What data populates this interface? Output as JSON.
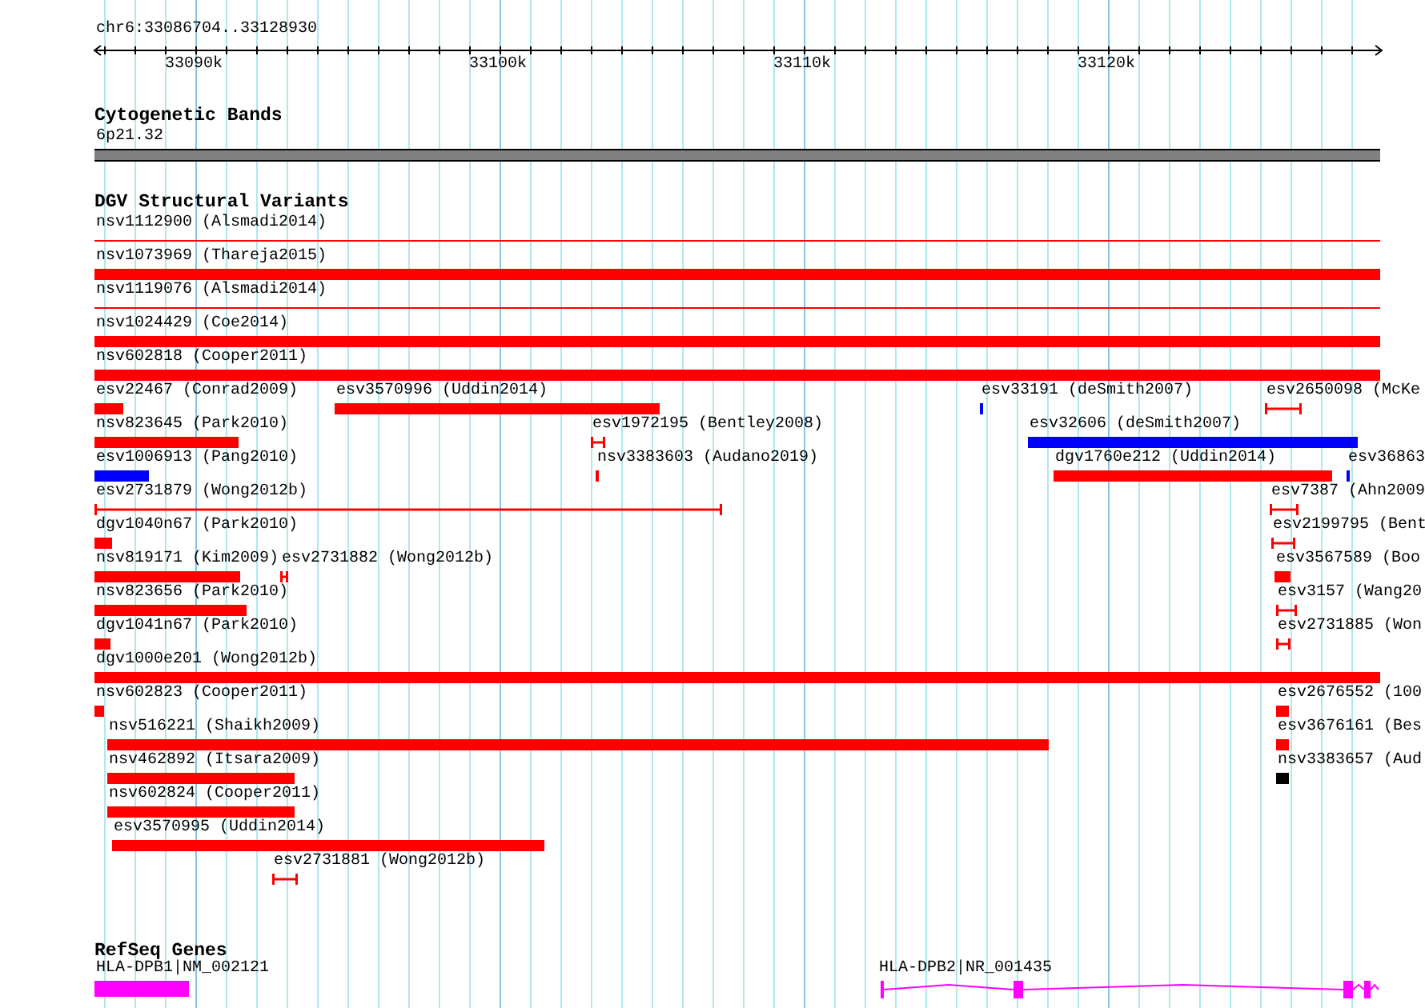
{
  "ruler": {
    "label": "chr6:33086704..33128930",
    "ticks": [
      "33090k",
      "33100k",
      "33110k",
      "33120k"
    ]
  },
  "bands": {
    "title": "Cytogenetic Bands",
    "label": "6p21.32"
  },
  "variants": {
    "title": "DGV Structural Variants",
    "features": [
      {
        "label": "nsv1112900 (Alsmadi2014)",
        "kind": "line",
        "color": "#ff0000"
      },
      {
        "label": "nsv1073969 (Thareja2015)",
        "kind": "bar",
        "color": "#ff0000"
      },
      {
        "label": "nsv1119076 (Alsmadi2014)",
        "kind": "line",
        "color": "#ff0000"
      },
      {
        "label": "nsv1024429 (Coe2014)",
        "kind": "bar",
        "color": "#ff0000"
      },
      {
        "label": "nsv602818 (Cooper2011)",
        "kind": "bar",
        "color": "#ff0000"
      },
      {
        "label": "esv22467 (Conrad2009)",
        "kind": "bar",
        "color": "#ff0000"
      },
      {
        "label": "esv3570996 (Uddin2014)",
        "kind": "bar",
        "color": "#ff0000"
      },
      {
        "label": "esv33191 (deSmith2007)",
        "kind": "bar",
        "color": "#0000ff"
      },
      {
        "label": "esv2650098 (McKe",
        "kind": "interval",
        "color": "#ff0000"
      },
      {
        "label": "nsv823645 (Park2010)",
        "kind": "bar",
        "color": "#ff0000"
      },
      {
        "label": "esv1972195 (Bentley2008)",
        "kind": "interval",
        "color": "#ff0000"
      },
      {
        "label": "esv32606 (deSmith2007)",
        "kind": "bar",
        "color": "#0000ff"
      },
      {
        "label": "esv1006913 (Pang2010)",
        "kind": "bar",
        "color": "#0000ff"
      },
      {
        "label": "nsv3383603 (Audano2019)",
        "kind": "bar",
        "color": "#ff0000"
      },
      {
        "label": "dgv1760e212 (Uddin2014)",
        "kind": "bar",
        "color": "#ff0000"
      },
      {
        "label": "esv36863",
        "kind": "bar",
        "color": "#0000ff"
      },
      {
        "label": "esv2731879 (Wong2012b)",
        "kind": "interval",
        "color": "#ff0000"
      },
      {
        "label": "esv7387 (Ahn2009",
        "kind": "interval",
        "color": "#ff0000"
      },
      {
        "label": "dgv1040n67 (Park2010)",
        "kind": "bar",
        "color": "#ff0000"
      },
      {
        "label": "esv2199795 (Bent",
        "kind": "interval",
        "color": "#ff0000"
      },
      {
        "label": "nsv819171 (Kim2009)",
        "kind": "bar",
        "color": "#ff0000"
      },
      {
        "label": "esv2731882 (Wong2012b)",
        "kind": "interval",
        "color": "#ff0000"
      },
      {
        "label": "esv3567589 (Boo",
        "kind": "bar",
        "color": "#ff0000"
      },
      {
        "label": "nsv823656 (Park2010)",
        "kind": "bar",
        "color": "#ff0000"
      },
      {
        "label": "esv3157 (Wang20",
        "kind": "interval",
        "color": "#ff0000"
      },
      {
        "label": "dgv1041n67 (Park2010)",
        "kind": "bar",
        "color": "#ff0000"
      },
      {
        "label": "esv2731885 (Won",
        "kind": "interval",
        "color": "#ff0000"
      },
      {
        "label": "dgv1000e201 (Wong2012b)",
        "kind": "bar",
        "color": "#ff0000"
      },
      {
        "label": "nsv602823 (Cooper2011)",
        "kind": "bar",
        "color": "#ff0000"
      },
      {
        "label": "esv2676552 (100",
        "kind": "bar",
        "color": "#ff0000"
      },
      {
        "label": "nsv516221 (Shaikh2009)",
        "kind": "bar",
        "color": "#ff0000"
      },
      {
        "label": "esv3676161 (Bes",
        "kind": "bar",
        "color": "#ff0000"
      },
      {
        "label": "nsv462892 (Itsara2009)",
        "kind": "bar",
        "color": "#ff0000"
      },
      {
        "label": "nsv3383657 (Aud",
        "kind": "bar",
        "color": "#000000"
      },
      {
        "label": "nsv602824 (Cooper2011)",
        "kind": "bar",
        "color": "#ff0000"
      },
      {
        "label": "esv3570995 (Uddin2014)",
        "kind": "bar",
        "color": "#ff0000"
      },
      {
        "label": "esv2731881 (Wong2012b)",
        "kind": "interval",
        "color": "#ff0000"
      }
    ]
  },
  "genes": {
    "title": "RefSeq Genes",
    "items": [
      {
        "label": "HLA-DPB1|NM_002121",
        "kind": "bar"
      },
      {
        "label": "HLA-DPB2|NR_001435",
        "kind": "model"
      }
    ]
  }
}
